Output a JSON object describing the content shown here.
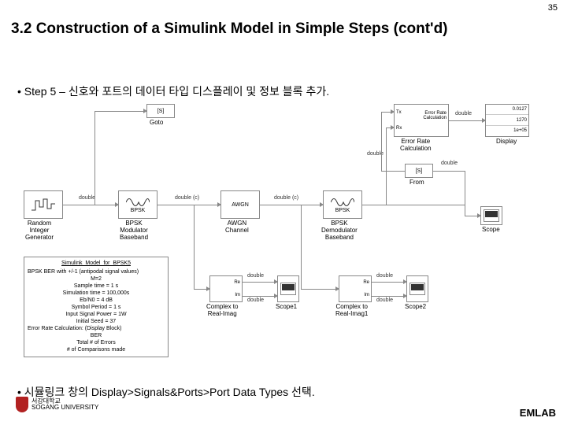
{
  "page_number": "35",
  "title": "3.2 Construction of a Simulink Model in Simple Steps (cont'd)",
  "bullet1_prefix": "• Step 5 – ",
  "bullet1_text": "신호와 포트의 데이터 타입 디스플레이 및 정보 블록 추가.",
  "bullet2_prefix": "• ",
  "bullet2_text": "시뮬링크 창의 Display>Signals&Ports>Port Data Types 선택.",
  "emlab": "EMLAB",
  "logo_text_kr": "서강대학교",
  "logo_text_en": "SOGANG UNIVERSITY",
  "diagram": {
    "goto_tag": "[S]",
    "goto_label": "Goto",
    "from_tag": "[S]",
    "from_label": "From",
    "random_label": "Random\nInteger\nGenerator",
    "bpsk_mod": "BPSK",
    "bpsk_mod_label": "BPSK\nModulator\nBaseband",
    "awgn": "AWGN",
    "awgn_label": "AWGN\nChannel",
    "bpsk_demod": "BPSK",
    "bpsk_demod_label": "BPSK\nDemodulator\nBaseband",
    "err_tx": "Tx",
    "err_rx": "Rx",
    "err_text": "Error Rate\nCalculation",
    "err_label": "Error Rate\nCalculation",
    "display_v1": "0.0127",
    "display_v2": "1270",
    "display_v3": "1e+05",
    "display_label": "Display",
    "scope_label": "Scope",
    "c2ri_re": "Re",
    "c2ri_im": "Im",
    "c2ri_label1": "Complex to\nReal-Imag",
    "c2ri_label2": "Complex to\nReal-Imag1",
    "scope1_label": "Scope1",
    "scope2_label": "Scope2",
    "info_title": "Simulink_Model_for_BPSK5",
    "info_l1": "BPSK BER with +/-1 (antipodal signal values)",
    "info_l2": "M=2",
    "info_l3": "Sample time = 1 s",
    "info_l4": "Simulation time = 100,000s",
    "info_l5": "Eb/N0 = 4 dB",
    "info_l6": "Symbol Period = 1 s",
    "info_l7": "Input Signal Power = 1W",
    "info_l8": "Initial Seed = 37",
    "info_l9": "Error Rate Calculation: (Display Block)",
    "info_l10": "BER",
    "info_l11": "Total # of Errors",
    "info_l12": "# of Comparisons made",
    "wire_double": "double",
    "wire_double_c": "double (c)"
  }
}
